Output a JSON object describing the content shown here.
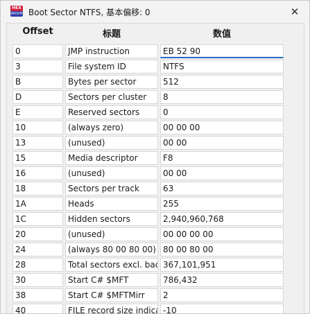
{
  "window": {
    "icon": {
      "top": "HEX",
      "bottom": "WKSHP"
    },
    "title": "Boot Sector NTFS, 基本偏移: 0",
    "close_glyph": "✕"
  },
  "table": {
    "headers": {
      "offset": "Offset",
      "title": "标题",
      "value": "数值"
    },
    "rows": [
      {
        "offset": "0",
        "title": "JMP instruction",
        "value": "EB 52 90"
      },
      {
        "offset": "3",
        "title": "File system ID",
        "value": "NTFS"
      },
      {
        "offset": "B",
        "title": "Bytes per sector",
        "value": "512"
      },
      {
        "offset": "D",
        "title": "Sectors per cluster",
        "value": "8"
      },
      {
        "offset": "E",
        "title": "Reserved sectors",
        "value": "0"
      },
      {
        "offset": "10",
        "title": "(always zero)",
        "value": "00 00 00"
      },
      {
        "offset": "13",
        "title": "(unused)",
        "value": "00 00"
      },
      {
        "offset": "15",
        "title": "Media descriptor",
        "value": "F8"
      },
      {
        "offset": "16",
        "title": "(unused)",
        "value": "00 00"
      },
      {
        "offset": "18",
        "title": "Sectors per track",
        "value": "63"
      },
      {
        "offset": "1A",
        "title": "Heads",
        "value": "255"
      },
      {
        "offset": "1C",
        "title": "Hidden sectors",
        "value": "2,940,960,768"
      },
      {
        "offset": "20",
        "title": "(unused)",
        "value": "00 00 00 00"
      },
      {
        "offset": "24",
        "title": "(always 80 00 80 00)",
        "value": "80 00 80 00"
      },
      {
        "offset": "28",
        "title": "Total sectors excl. bac",
        "value": "367,101,951"
      },
      {
        "offset": "30",
        "title": "Start C# $MFT",
        "value": "786,432"
      },
      {
        "offset": "38",
        "title": "Start C# $MFTMirr",
        "value": "2"
      },
      {
        "offset": "40",
        "title": "FILE record size indica",
        "value": "-10"
      }
    ]
  }
}
